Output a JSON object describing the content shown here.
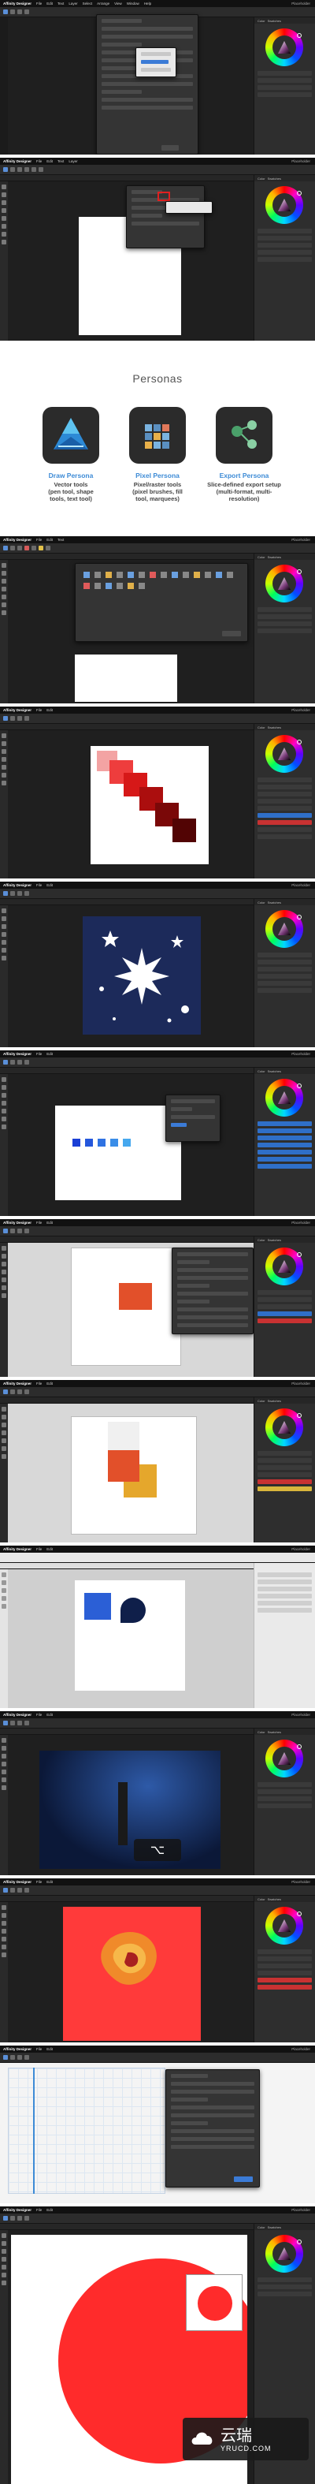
{
  "menubar": {
    "app_name": "Affinity Designer",
    "items": [
      "File",
      "Edit",
      "Text",
      "Layer",
      "Select",
      "Arrange",
      "View",
      "Window",
      "Help"
    ],
    "persona_label": "Placeholder"
  },
  "panel_tabs": [
    "Color",
    "Swatches",
    "Stroke",
    "Brushes"
  ],
  "personas": {
    "title": "Personas",
    "items": [
      {
        "name": "Draw Persona",
        "desc": [
          "Vector tools",
          "(pen tool, shape",
          "tools, text tool)"
        ],
        "icon": "affinity-designer-logo-icon"
      },
      {
        "name": "Pixel Persona",
        "desc": [
          "Pixel/raster tools",
          "(pixel brushes, fill",
          "tool, marquees)"
        ],
        "icon": "pixel-grid-icon"
      },
      {
        "name": "Export Persona",
        "desc": [
          "Slice-defined export setup",
          "(multi-format, multi-",
          "resolution)"
        ],
        "icon": "export-nodes-icon"
      }
    ]
  },
  "keyboard_overlay": {
    "key": "⌥"
  },
  "watermark": {
    "text": "云瑞",
    "subtext": "YRUCD.COM"
  },
  "colors": {
    "accent": "#3d8bd6",
    "app_bg": "#1b1b1b",
    "panel_bg": "#2e2e2e",
    "red_shape": "#ff3a3a",
    "star_bg": "#1c2a5a",
    "orange_rect": "#e2502a",
    "yellow_rect": "#e5a72c",
    "blue_shape": "#2b5fd6",
    "navy_shape": "#0f1f4a"
  }
}
